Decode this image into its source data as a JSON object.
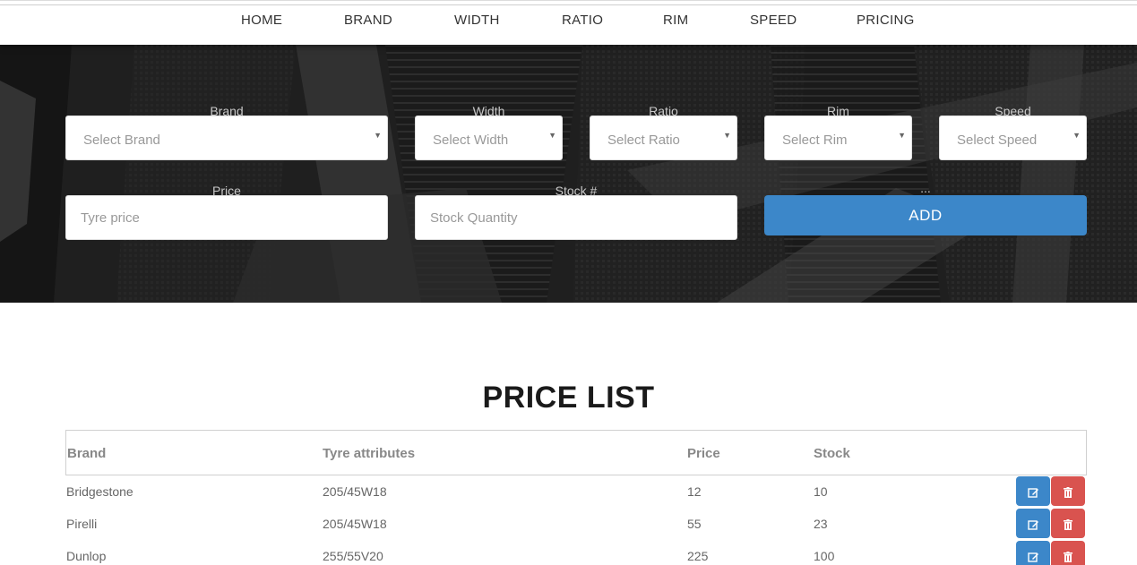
{
  "nav": {
    "items": [
      "HOME",
      "BRAND",
      "WIDTH",
      "RATIO",
      "RIM",
      "SPEED",
      "PRICING"
    ]
  },
  "form": {
    "brand_label": "Brand",
    "brand_placeholder": "Select Brand",
    "width_label": "Width",
    "width_placeholder": "Select Width",
    "ratio_label": "Ratio",
    "ratio_placeholder": "Select Ratio",
    "rim_label": "Rim",
    "rim_placeholder": "Select Rim",
    "speed_label": "Speed",
    "speed_placeholder": "Select Speed",
    "price_label": "Price",
    "price_placeholder": "Tyre price",
    "stock_label": "Stock #",
    "stock_placeholder": "Stock Quantity",
    "add_label": "...",
    "add_button": "ADD",
    "caret": "▼"
  },
  "price_list": {
    "title": "PRICE LIST",
    "columns": [
      "Brand",
      "Tyre attributes",
      "Price",
      "Stock"
    ],
    "rows": [
      {
        "brand": "Bridgestone",
        "attributes": "205/45W18",
        "price": "12",
        "stock": "10"
      },
      {
        "brand": "Pirelli",
        "attributes": "205/45W18",
        "price": "55",
        "stock": "23"
      },
      {
        "brand": "Dunlop",
        "attributes": "255/55V20",
        "price": "225",
        "stock": "100"
      }
    ]
  },
  "colors": {
    "primary": "#3c87c9",
    "danger": "#d9534f",
    "hero_bg": "#2b2b2b"
  },
  "icons": {
    "edit": "edit-icon",
    "delete": "trash-icon"
  }
}
